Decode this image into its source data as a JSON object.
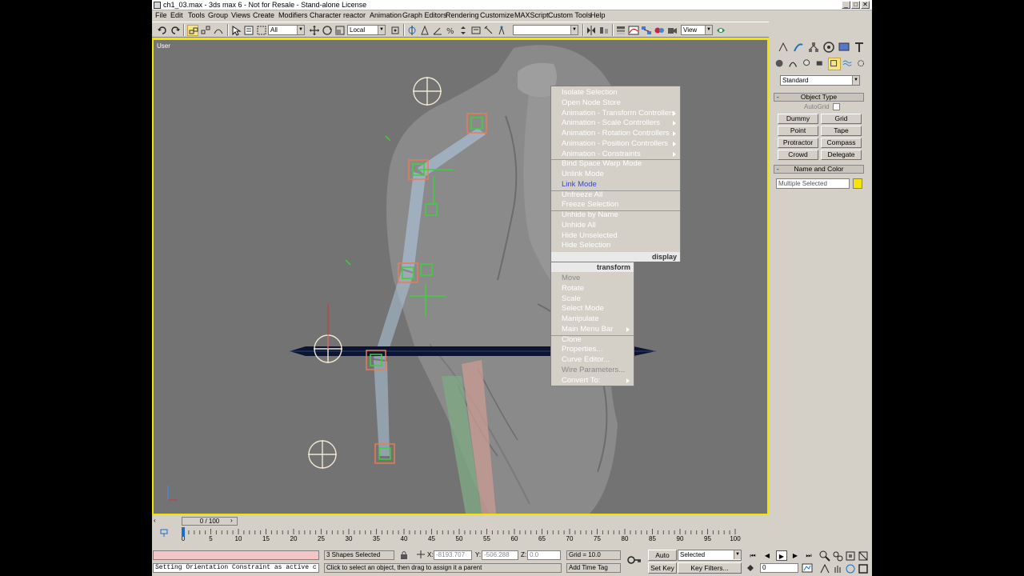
{
  "window": {
    "title": "ch1_03.max - 3ds max 6 - Not for Resale - Stand-alone License",
    "min": "_",
    "max": "□",
    "close": "✕"
  },
  "menubar": [
    "File",
    "Edit",
    "Tools",
    "Group",
    "Views",
    "Create",
    "Modifiers",
    "Character",
    "reactor",
    "Animation",
    "Graph Editors",
    "Rendering",
    "Customize",
    "MAXScript",
    "Custom Tools",
    "Help"
  ],
  "toolbar": {
    "selection_filter": "All",
    "coord_system": "Local",
    "named_selection": "",
    "view_dropdown": "View"
  },
  "viewport": {
    "label": "User",
    "active_border_color": "#f2e400"
  },
  "quad_display": {
    "header": "display",
    "items": [
      {
        "label": "Isolate Selection",
        "state": "normal",
        "sub": false
      },
      {
        "label": "Open Node Store",
        "state": "normal",
        "sub": false
      },
      {
        "label": "Animation - Transform Controllers",
        "state": "normal",
        "sub": true
      },
      {
        "label": "Animation - Scale Controllers",
        "state": "normal",
        "sub": true
      },
      {
        "label": "Animation - Rotation Controllers",
        "state": "normal",
        "sub": true
      },
      {
        "label": "Animation - Position Controllers",
        "state": "normal",
        "sub": true
      },
      {
        "label": "Animation - Constraints",
        "state": "normal",
        "sub": true
      },
      {
        "label": "Bind Space Warp Mode",
        "state": "normal",
        "sub": false
      },
      {
        "label": "Unlink Mode",
        "state": "normal",
        "sub": false
      },
      {
        "label": "Link Mode",
        "state": "highlight",
        "sub": false
      },
      {
        "label": "Unfreeze All",
        "state": "normal",
        "sub": false
      },
      {
        "label": "Freeze Selection",
        "state": "normal",
        "sub": false
      },
      {
        "label": "Unhide by Name",
        "state": "normal",
        "sub": false
      },
      {
        "label": "Unhide All",
        "state": "normal",
        "sub": false
      },
      {
        "label": "Hide Unselected",
        "state": "normal",
        "sub": false
      },
      {
        "label": "Hide Selection",
        "state": "normal",
        "sub": false
      }
    ]
  },
  "quad_transform": {
    "header": "transform",
    "items": [
      {
        "label": "Move",
        "state": "disabled",
        "sub": false
      },
      {
        "label": "Rotate",
        "state": "normal",
        "sub": false
      },
      {
        "label": "Scale",
        "state": "normal",
        "sub": false
      },
      {
        "label": "Select Mode",
        "state": "normal",
        "sub": false
      },
      {
        "label": "Manipulate",
        "state": "normal",
        "sub": false
      },
      {
        "label": "Main Menu Bar",
        "state": "normal",
        "sub": true
      },
      {
        "label": "Clone",
        "state": "normal",
        "sub": false
      },
      {
        "label": "Properties...",
        "state": "normal",
        "sub": false
      },
      {
        "label": "Curve Editor...",
        "state": "normal",
        "sub": false
      },
      {
        "label": "Wire Parameters...",
        "state": "disabled",
        "sub": false
      },
      {
        "label": "Convert To:",
        "state": "normal",
        "sub": true
      }
    ]
  },
  "command_panel": {
    "category": "Standard",
    "object_type_header": "Object Type",
    "autogrid_label": "AutoGrid",
    "buttons": [
      "Dummy",
      "Grid",
      "Point",
      "Tape",
      "Protractor",
      "Compass",
      "Crowd",
      "Delegate"
    ],
    "name_color_header": "Name and Color",
    "name_field": "Multiple Selected",
    "swatch_color": "#f5e40a"
  },
  "timeline": {
    "frame": "0 / 100",
    "ticks": [
      "0",
      "5",
      "10",
      "15",
      "20",
      "25",
      "30",
      "35",
      "40",
      "45",
      "50",
      "55",
      "60",
      "65",
      "70",
      "75",
      "80",
      "85",
      "90",
      "95",
      "100"
    ]
  },
  "status": {
    "maxscript_line": "Setting Orientation Constraint as active c",
    "selection_count": "3 Shapes Selected",
    "prompt": "Click to select an object, then drag to assign it a parent",
    "x_label": "X:",
    "x": "-8193.707",
    "y_label": "Y:",
    "y": "-506.288",
    "z_label": "Z:",
    "z": "0.0",
    "grid": "Grid = 10.0",
    "add_time_tag": "Add Time Tag",
    "auto_key": "Auto Key",
    "set_key": "Set Key",
    "key_mode": "Selected",
    "key_filters": "Key Filters...",
    "current_frame": "0"
  }
}
